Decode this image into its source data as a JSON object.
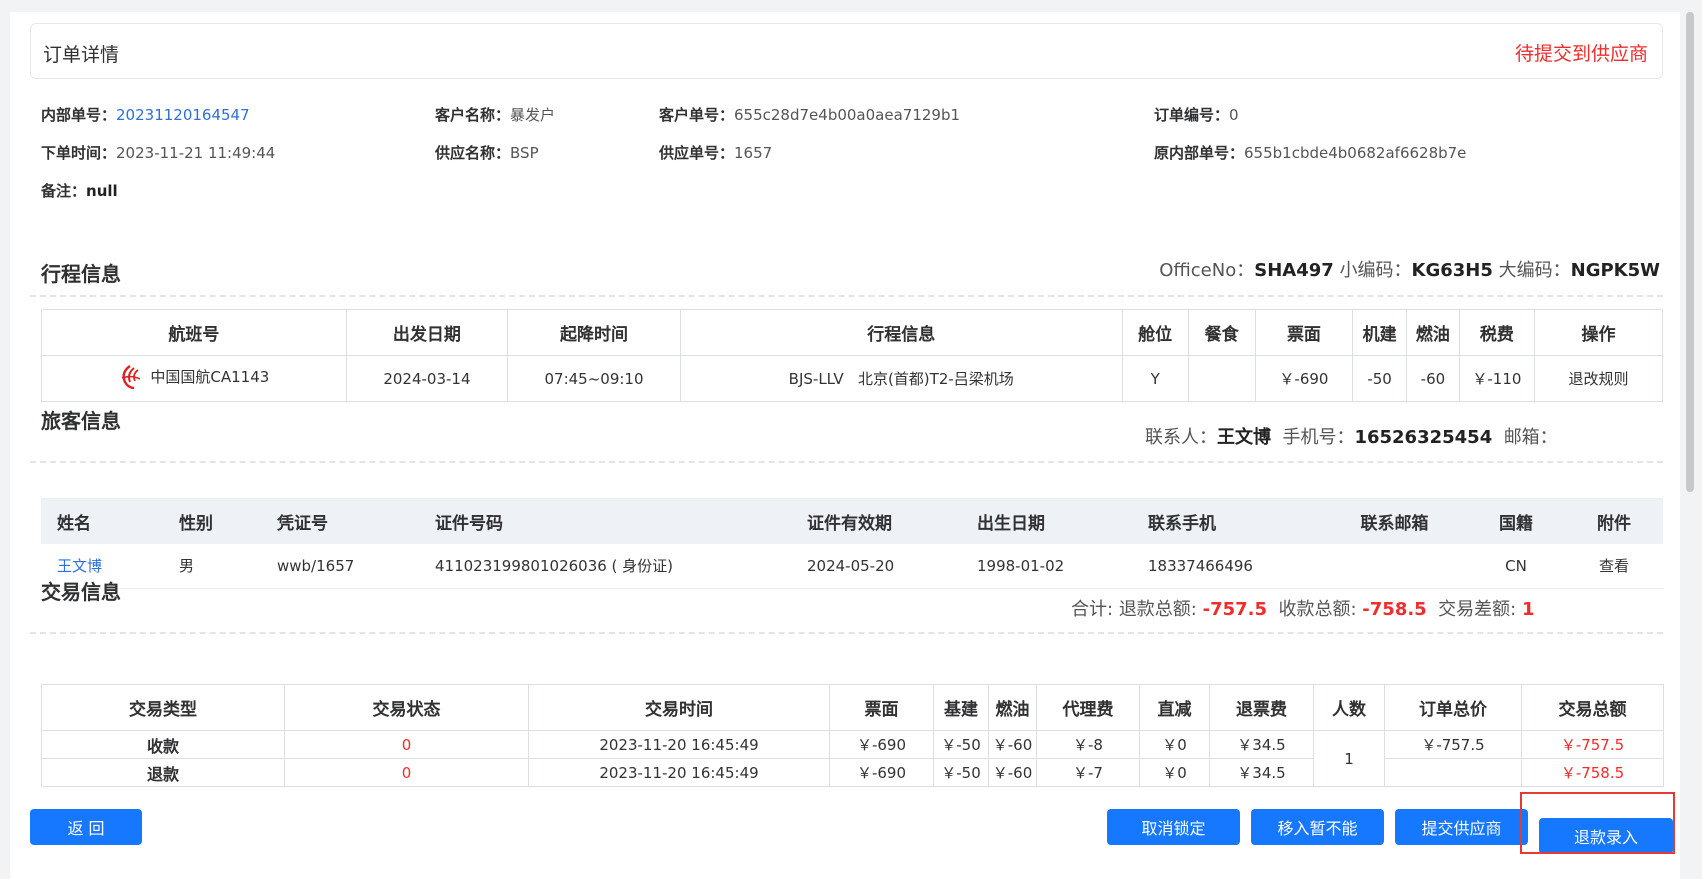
{
  "header": {
    "title": "订单详情",
    "status": "待提交到供应商"
  },
  "order": {
    "internal_no_label": "内部单号：",
    "internal_no": "20231120164547",
    "customer_name_label": "客户名称：",
    "customer_name": "暴发户",
    "customer_no_label": "客户单号：",
    "customer_no": "655c28d7e4b00a0aea7129b1",
    "order_no_label": "订单编号：",
    "order_no": "0",
    "order_time_label": "下单时间：",
    "order_time": "2023-11-21 11:49:44",
    "supplier_name_label": "供应名称：",
    "supplier_name": "BSP",
    "supplier_no_label": "供应单号：",
    "supplier_no": "1657",
    "orig_internal_no_label": "原内部单号：",
    "orig_internal_no": "655b1cbde4b0682af6628b7e",
    "remark_label": "备注：",
    "remark": "null"
  },
  "itinerary": {
    "title": "行程信息",
    "office_label": "OfficeNo：",
    "office": "SHA497",
    "small_code_label": "小编码：",
    "small_code": "KG63H5",
    "big_code_label": "大编码：",
    "big_code": "NGPK5W",
    "columns": [
      "航班号",
      "出发日期",
      "起降时间",
      "行程信息",
      "舱位",
      "餐食",
      "票面",
      "机建",
      "燃油",
      "税费",
      "操作"
    ],
    "rows": [
      {
        "flight": "中国国航CA1143",
        "date": "2024-03-14",
        "time": "07:45~09:10",
        "route": "BJS-LLV   北京(首都)T2-吕梁机场",
        "cabin": "Y",
        "meal": "",
        "fare": "￥-690",
        "airport_fee": "-50",
        "fuel": "-60",
        "tax": "￥-110",
        "action": "退改规则"
      }
    ]
  },
  "passenger": {
    "title": "旅客信息",
    "contact_label": "联系人：",
    "contact": "王文博",
    "phone_label": "手机号：",
    "phone": "16526325454",
    "email_label": "邮箱：",
    "email": "",
    "columns": [
      "姓名",
      "性别",
      "凭证号",
      "证件号码",
      "证件有效期",
      "出生日期",
      "联系手机",
      "联系邮箱",
      "国籍",
      "附件"
    ],
    "rows": [
      {
        "name": "王文博",
        "gender": "男",
        "voucher": "wwb/1657",
        "id_no": "411023199801026036 ( 身份证)",
        "id_expiry": "2024-05-20",
        "birth": "1998-01-02",
        "mobile": "18337466496",
        "email": "",
        "nationality": "CN",
        "attachment": "查看"
      }
    ]
  },
  "trade": {
    "title": "交易信息",
    "total_label": "合计:",
    "refund_total_label": "退款总额:",
    "refund_total": "-757.5",
    "receive_total_label": "收款总额:",
    "receive_total": "-758.5",
    "diff_label": "交易差额:",
    "diff": "1",
    "columns": [
      "交易类型",
      "交易状态",
      "交易时间",
      "票面",
      "基建",
      "燃油",
      "代理费",
      "直减",
      "退票费",
      "人数",
      "订单总价",
      "交易总额"
    ],
    "people": "1",
    "rows": [
      {
        "type": "收款",
        "status": "0",
        "time": "2023-11-20 16:45:49",
        "fare": "￥-690",
        "base": "￥-50",
        "fuel": "￥-60",
        "agent_fee": "￥-8",
        "discount": "￥0",
        "refund_fee": "￥34.5",
        "order_total": "￥-757.5",
        "trade_total": "￥-757.5"
      },
      {
        "type": "退款",
        "status": "0",
        "time": "2023-11-20 16:45:49",
        "fare": "￥-690",
        "base": "￥-50",
        "fuel": "￥-60",
        "agent_fee": "￥-7",
        "discount": "￥0",
        "refund_fee": "￥34.5",
        "order_total": "",
        "trade_total": "￥-758.5"
      }
    ]
  },
  "buttons": {
    "back": "返 回",
    "cancel_lock": "取消锁定",
    "move_pending": "移入暂不能",
    "submit_supplier": "提交供应商",
    "refund_entry": "退款录入"
  },
  "colors": {
    "primary": "#1677ff",
    "danger": "#f02c2c",
    "link": "#2f6fda"
  }
}
